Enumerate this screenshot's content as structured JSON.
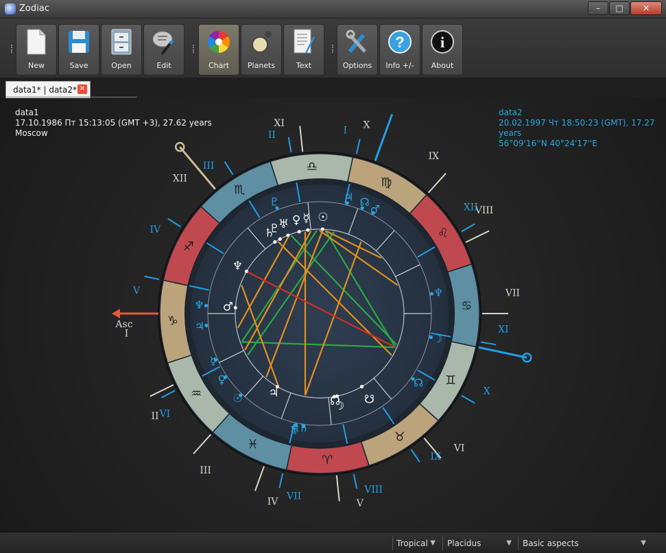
{
  "window": {
    "title": "Zodiac"
  },
  "toolbar": {
    "groups": [
      [
        {
          "id": "new",
          "label": "New",
          "icon": "new-file-icon"
        },
        {
          "id": "save",
          "label": "Save",
          "icon": "save-floppy-icon"
        },
        {
          "id": "open",
          "label": "Open",
          "icon": "open-cabinet-icon"
        },
        {
          "id": "edit",
          "label": "Edit",
          "icon": "edit-pen-icon"
        }
      ],
      [
        {
          "id": "chart",
          "label": "Chart",
          "icon": "chart-wheel-icon",
          "active": true
        },
        {
          "id": "planets",
          "label": "Planets",
          "icon": "planets-icon"
        },
        {
          "id": "text",
          "label": "Text",
          "icon": "text-document-icon"
        }
      ],
      [
        {
          "id": "options",
          "label": "Options",
          "icon": "options-tools-icon"
        },
        {
          "id": "info",
          "label": "Info +/-",
          "icon": "info-question-icon"
        },
        {
          "id": "about",
          "label": "About",
          "icon": "about-info-icon"
        }
      ]
    ]
  },
  "tabs": [
    {
      "label": "data1* | data2*"
    }
  ],
  "data1": {
    "name": "data1",
    "line1": "17.10.1986 Пт 15:13:05 (GMT +3), 27.62 years",
    "line2": "Moscow"
  },
  "data2": {
    "name": "data2",
    "line1": "20.02.1997 Чт 18:50:23 (GMT), 17.27 years",
    "line2": "56°09'16''N  40°24'17''E"
  },
  "chart_data": {
    "type": "other",
    "zodiac_signs": [
      "♈",
      "♉",
      "♊",
      "♋",
      "♌",
      "♍",
      "♎",
      "♏",
      "♐",
      "♑",
      "♒",
      "♓"
    ],
    "inner_houses": [
      "I",
      "II",
      "III",
      "IV",
      "V",
      "VI",
      "VII",
      "VIII",
      "IX",
      "X",
      "XI",
      "XII"
    ],
    "outer_houses": [
      "I",
      "II",
      "III",
      "IV",
      "V",
      "VI",
      "VII",
      "VIII",
      "IX",
      "X",
      "XI",
      "XII"
    ],
    "asc_label": "Asc",
    "mc_label": "X",
    "outer_asc_label": "Asc",
    "colors": {
      "data1": "#e0e0e0",
      "data2": "#29a8e0",
      "fire": "#c0494f",
      "earth": "#bba37c",
      "air": "#a9b8aa",
      "water": "#5e8fa3",
      "asc_arrow": "#e65a36",
      "aspect_green": "#2aa845",
      "aspect_orange": "#e09020",
      "aspect_red": "#d03020"
    }
  },
  "status": {
    "zodiac": "Tropical",
    "houses": "Placidus",
    "aspects": "Basic aspects"
  }
}
